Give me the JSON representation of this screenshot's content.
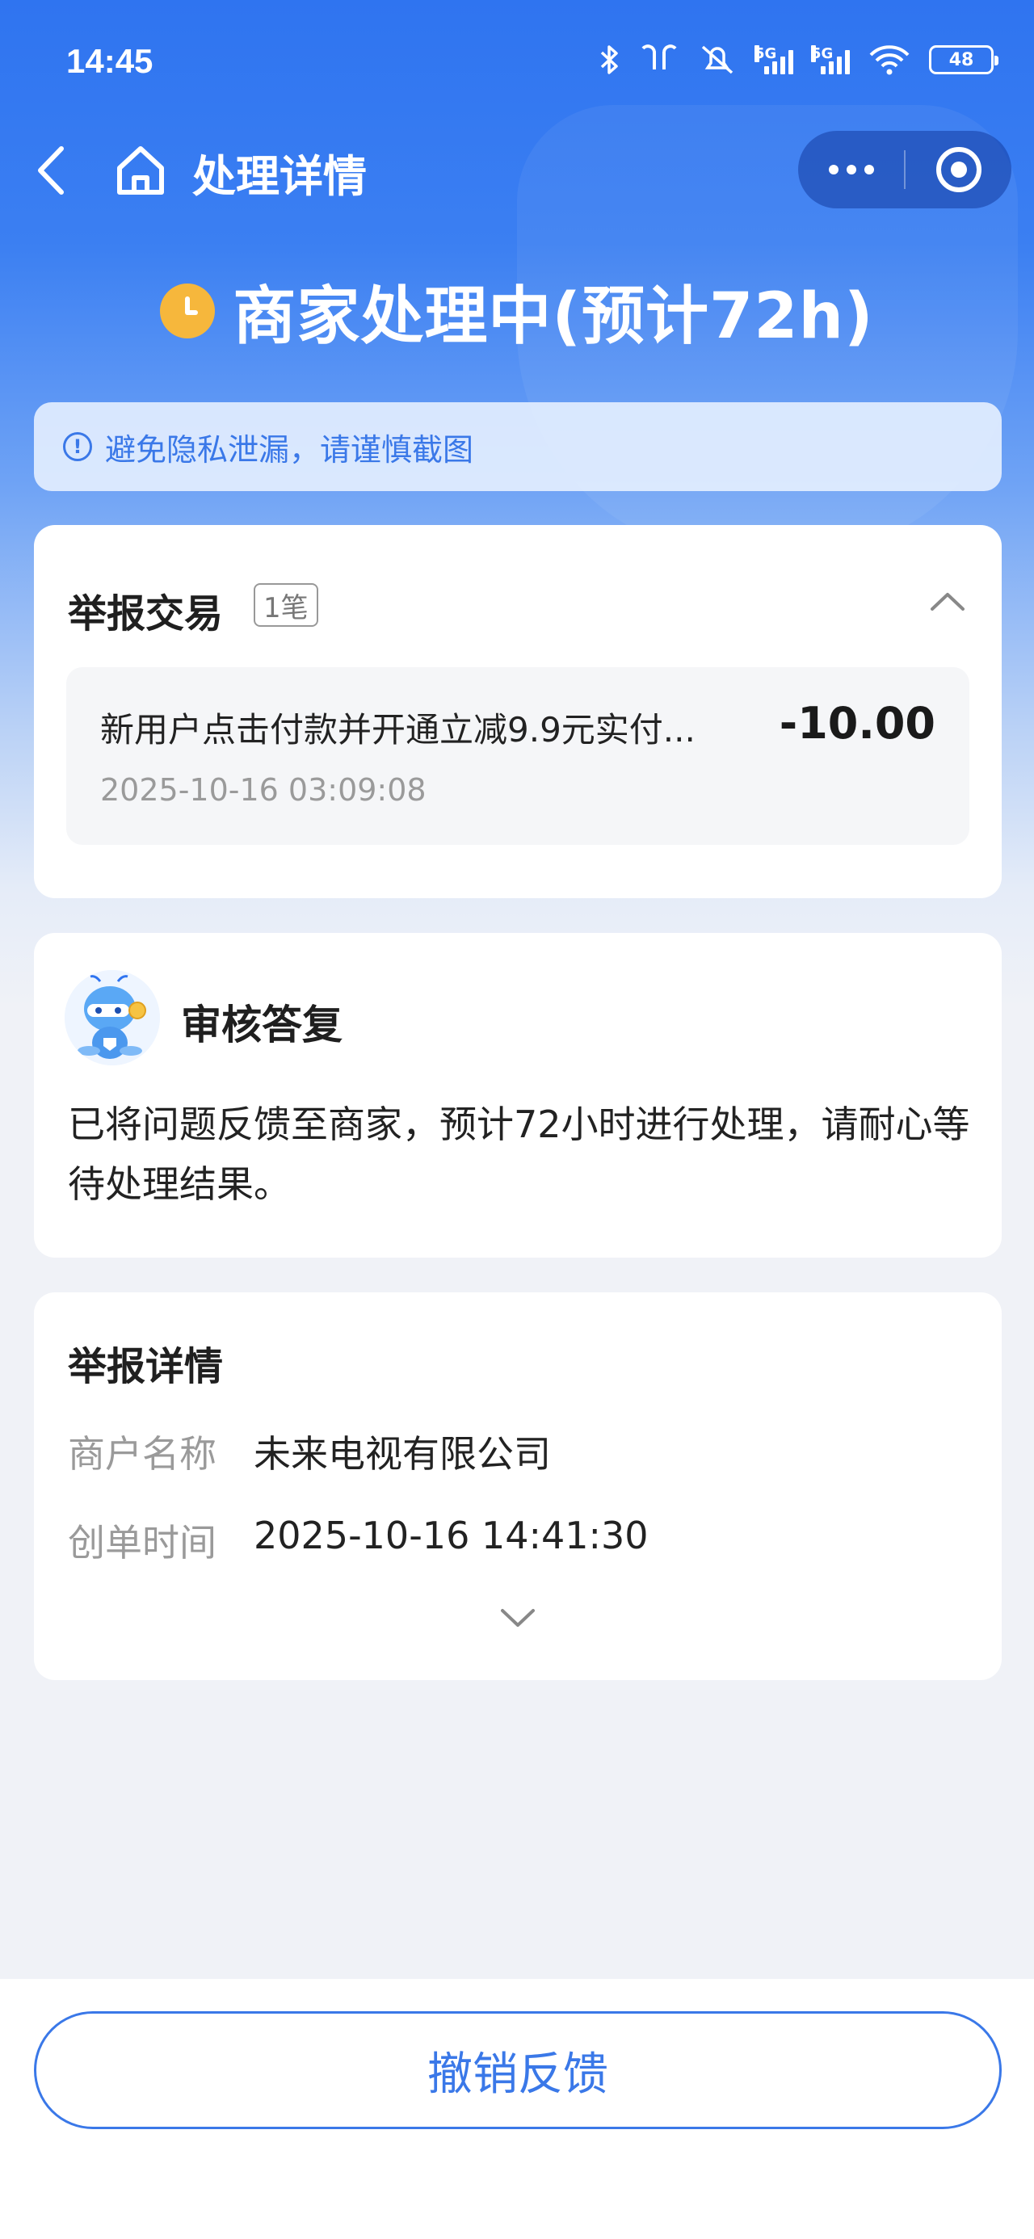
{
  "status_bar": {
    "time": "14:45",
    "network_1": "5G",
    "network_2": "5G",
    "battery": "48"
  },
  "nav": {
    "title": "处理详情"
  },
  "status": {
    "text": "商家处理中(预计72h)",
    "icon": "clock-icon",
    "icon_color": "#f6b73c"
  },
  "notice": {
    "text": "避免隐私泄漏，请谨慎截图"
  },
  "trade_card": {
    "title": "举报交易",
    "count": "1笔",
    "item": {
      "description": "新用户点击付款并开通立减9.9元实付...",
      "amount": "-10.00",
      "time": "2025-10-16 03:09:08"
    }
  },
  "review_card": {
    "title": "审核答复",
    "body": "已将问题反馈至商家，预计72小时进行处理，请耐心等待处理结果。"
  },
  "detail_card": {
    "title": "举报详情",
    "rows": [
      {
        "label": "商户名称",
        "value": "未来电视有限公司"
      },
      {
        "label": "创单时间",
        "value": "2025-10-16 14:41:30"
      }
    ]
  },
  "bottom": {
    "revoke_label": "撤销反馈"
  },
  "colors": {
    "primary": "#3a78e8",
    "header_blue": "#2f74f0"
  }
}
